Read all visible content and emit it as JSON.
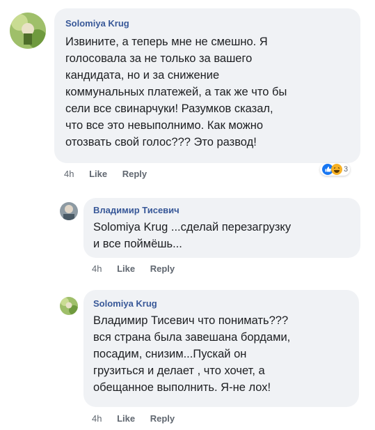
{
  "comments": [
    {
      "author": "Solomiya Krug",
      "text": "Извините, а теперь мне не смешно. Я\nголосовала за не только за вашего\nкандидата, но и за снижение\nкоммунальных платежей, а так же что бы\nсели все свинарчуки! Разумков сказал,\nчто все это невыполнимо. Как можно\nотозвать свой голос??? Это развод!",
      "time": "4h",
      "like": "Like",
      "reply": "Reply",
      "reactions": {
        "icons": [
          "like-reaction-icon",
          "haha-reaction-icon"
        ],
        "count": "3"
      }
    },
    {
      "author": "Владимир Тисевич",
      "text": "Solomiya Krug ...сделай перезагрузку\nи все поймёшь...",
      "time": "4h",
      "like": "Like",
      "reply": "Reply"
    },
    {
      "author": "Solomiya Krug",
      "text": "Владимир Тисевич что понимать???\nвся страна была завешана бордами,\nпосадим, снизим...Пускай он\nгрузиться и делает , что хочет, а\nобещанное выполнить. Я-не лох!",
      "time": "4h",
      "like": "Like",
      "reply": "Reply"
    }
  ],
  "colors": {
    "author": "#385898",
    "bubble": "#f0f2f5",
    "text": "#1c1e21",
    "meta": "#606770",
    "like_reaction": "#1877f2",
    "haha_reaction": "#f7b125"
  }
}
